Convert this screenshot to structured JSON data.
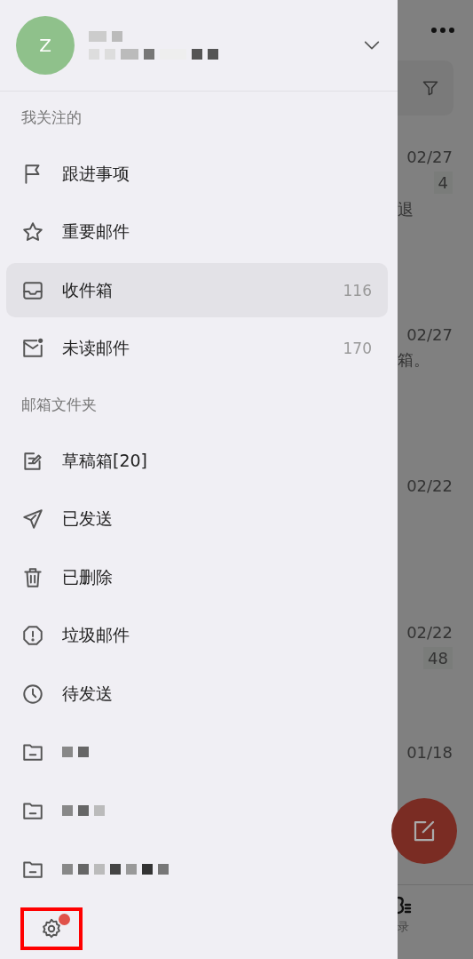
{
  "account": {
    "avatar_letter": "Z"
  },
  "sections": [
    {
      "title": "我关注的",
      "items": [
        {
          "kind": "flag",
          "label": "跟进事项",
          "selected": false
        },
        {
          "kind": "star",
          "label": "重要邮件",
          "selected": false
        },
        {
          "kind": "inbox",
          "label": "收件箱",
          "count": "116",
          "selected": true
        },
        {
          "kind": "unread",
          "label": "未读邮件",
          "count": "170",
          "selected": false
        }
      ]
    },
    {
      "title": "邮箱文件夹",
      "items": [
        {
          "kind": "draft",
          "label": "草稿箱[20]",
          "selected": false
        },
        {
          "kind": "sent",
          "label": "已发送",
          "selected": false
        },
        {
          "kind": "trash",
          "label": "已删除",
          "selected": false
        },
        {
          "kind": "spam",
          "label": "垃圾邮件",
          "selected": false
        },
        {
          "kind": "clock",
          "label": "待发送",
          "selected": false
        },
        {
          "kind": "folder",
          "label_redacted": true,
          "selected": false
        },
        {
          "kind": "folder",
          "label_redacted": true,
          "selected": false
        },
        {
          "kind": "folder",
          "label_redacted": true,
          "selected": false
        }
      ]
    }
  ],
  "settings": {
    "has_badge": true,
    "highlighted": true
  },
  "background_list": [
    {
      "date": "02/27",
      "count": "4",
      "snippet": "退"
    },
    {
      "date": "02/27",
      "snippet": "箱。"
    },
    {
      "date": "02/22"
    },
    {
      "date": "02/22",
      "count": "48"
    },
    {
      "date": "01/18"
    }
  ],
  "background_tab": {
    "label": "录"
  }
}
